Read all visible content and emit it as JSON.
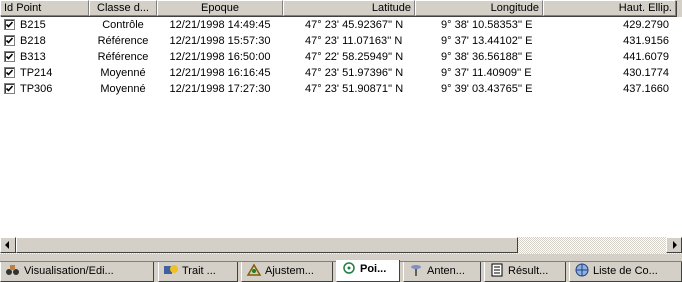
{
  "columns": [
    {
      "label": "Id Point"
    },
    {
      "label": "Classe d..."
    },
    {
      "label": "Epoque"
    },
    {
      "label": "Latitude"
    },
    {
      "label": "Longitude"
    },
    {
      "label": "Haut. Ellip."
    }
  ],
  "rows": [
    {
      "id": "B215",
      "classe": "Contrôle",
      "epoque": "12/21/1998 14:49:45",
      "lat": "47° 23' 45.92367'' N",
      "lon": "9° 38' 10.58353'' E",
      "haut": "429.2790",
      "checked": true
    },
    {
      "id": "B218",
      "classe": "Référence",
      "epoque": "12/21/1998 15:57:30",
      "lat": "47° 23' 11.07163'' N",
      "lon": "9° 37' 13.44102'' E",
      "haut": "431.9156",
      "checked": true
    },
    {
      "id": "B313",
      "classe": "Référence",
      "epoque": "12/21/1998 16:50:00",
      "lat": "47° 22' 58.25949'' N",
      "lon": "9° 38' 36.56188'' E",
      "haut": "441.6079",
      "checked": true
    },
    {
      "id": "TP214",
      "classe": "Moyenné",
      "epoque": "12/21/1998 16:16:45",
      "lat": "47° 23' 51.97396'' N",
      "lon": "9° 37' 11.40909'' E",
      "haut": "430.1774",
      "checked": true
    },
    {
      "id": "TP306",
      "classe": "Moyenné",
      "epoque": "12/21/1998 17:27:30",
      "lat": "47° 23' 51.90871'' N",
      "lon": "9° 39' 03.43765'' E",
      "haut": "437.1660",
      "checked": true
    }
  ],
  "tabs": [
    {
      "label": "Visualisation/Edi...",
      "icon": "binoculars-icon"
    },
    {
      "label": "Trait ...",
      "icon": "processing-icon"
    },
    {
      "label": "Ajustem...",
      "icon": "adjustment-icon"
    },
    {
      "label": "Poi...",
      "icon": "points-icon",
      "active": true
    },
    {
      "label": "Anten...",
      "icon": "antenna-icon"
    },
    {
      "label": "Résult...",
      "icon": "results-icon"
    },
    {
      "label": "Liste de Co...",
      "icon": "coordinates-list-icon"
    }
  ]
}
